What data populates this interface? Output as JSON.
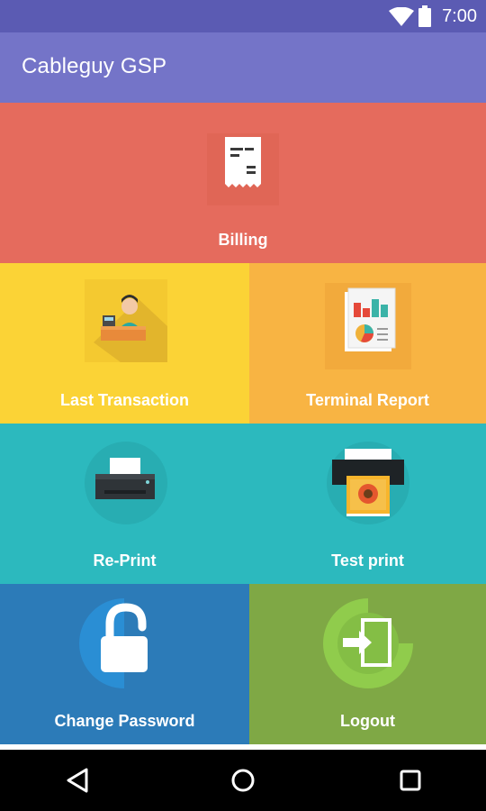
{
  "status_bar": {
    "time": "7:00",
    "icons": [
      "wifi-icon",
      "battery-icon"
    ]
  },
  "app_bar": {
    "title": "Cableguy GSP"
  },
  "tiles": {
    "billing": {
      "label": "Billing",
      "icon": "receipt-icon",
      "color": "#e56b5d"
    },
    "last_transaction": {
      "label": "Last Transaction",
      "icon": "cashier-icon",
      "color": "#fbd336"
    },
    "terminal_report": {
      "label": "Terminal Report",
      "icon": "report-icon",
      "color": "#f8b443"
    },
    "reprint": {
      "label": "Re-Print",
      "icon": "printer-icon",
      "color": "#2cb9be"
    },
    "test_print": {
      "label": "Test print",
      "icon": "photo-printer-icon",
      "color": "#2cb9be"
    },
    "change_password": {
      "label": "Change Password",
      "icon": "unlock-icon",
      "color": "#2c7bb8"
    },
    "logout": {
      "label": "Logout",
      "icon": "logout-door-icon",
      "color": "#7fa845"
    }
  },
  "nav_bar": {
    "buttons": [
      "back-icon",
      "home-icon",
      "recents-icon"
    ]
  }
}
